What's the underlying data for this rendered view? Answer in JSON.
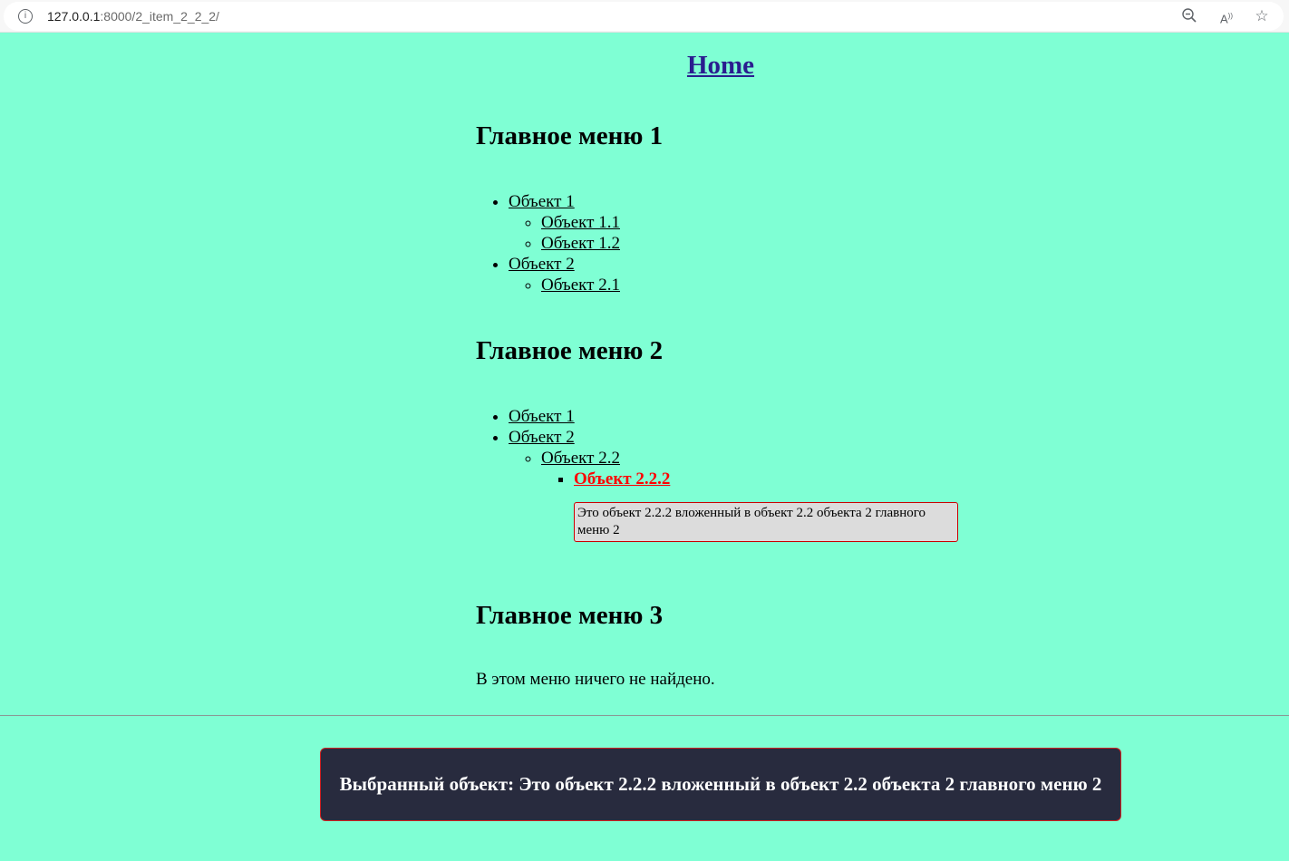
{
  "browser": {
    "url_host": "127.0.0.1",
    "url_rest": ":8000/2_item_2_2_2/",
    "icons": [
      "info-icon",
      "zoom-out-icon",
      "read-aloud-icon",
      "favorite-star-icon"
    ]
  },
  "page": {
    "home_label": "Home",
    "background_color": "#7fffd4"
  },
  "menu1": {
    "title": "Главное меню 1",
    "item1": "Объект 1",
    "item1_1": "Объект 1.1",
    "item1_2": "Объект 1.2",
    "item2": "Объект 2",
    "item2_1": "Объект 2.1"
  },
  "menu2": {
    "title": "Главное меню 2",
    "item1": "Объект 1",
    "item2": "Объект 2",
    "item2_2": "Объект 2.2",
    "item2_2_2": "Объект 2.2.2",
    "item2_2_2_description": "Это объект 2.2.2 вложенный в объект 2.2 объекта 2 главного меню 2",
    "active_color": "#ff0000"
  },
  "menu3": {
    "title": "Главное меню 3",
    "empty_message": "В этом меню ничего не найдено."
  },
  "footer": {
    "selected_text": "Выбранный объект: Это объект 2.2.2 вложенный в объект 2.2 объекта 2 главного меню 2"
  }
}
